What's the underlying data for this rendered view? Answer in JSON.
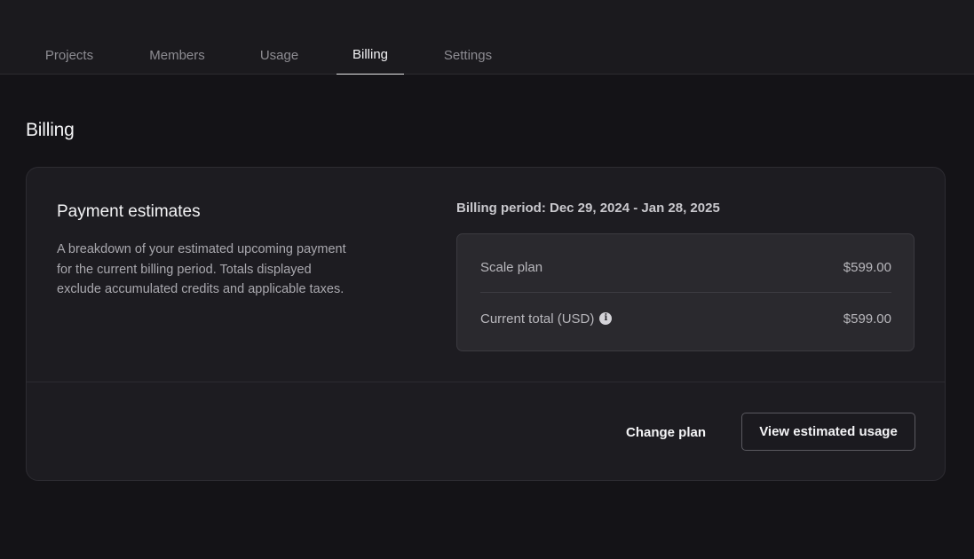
{
  "tabs": [
    {
      "label": "Projects",
      "active": false
    },
    {
      "label": "Members",
      "active": false
    },
    {
      "label": "Usage",
      "active": false
    },
    {
      "label": "Billing",
      "active": true
    },
    {
      "label": "Settings",
      "active": false
    }
  ],
  "page": {
    "title": "Billing"
  },
  "payment_estimates": {
    "title": "Payment estimates",
    "description": "A breakdown of your estimated upcoming payment for the current billing period. Totals displayed exclude accumulated credits and applicable taxes.",
    "billing_period": "Billing period: Dec 29, 2024 - Jan 28, 2025",
    "rows": [
      {
        "label": "Scale plan",
        "value": "$599.00"
      },
      {
        "label": "Current total (USD)",
        "value": "$599.00"
      }
    ],
    "info_icon": "info-icon"
  },
  "actions": {
    "change_plan": "Change plan",
    "view_usage": "View estimated usage"
  },
  "colors": {
    "background": "#141317",
    "card": "#1d1c21",
    "summary_box": "#2a292e",
    "text_primary": "#f4f4f6",
    "text_muted": "#8d8c92"
  }
}
